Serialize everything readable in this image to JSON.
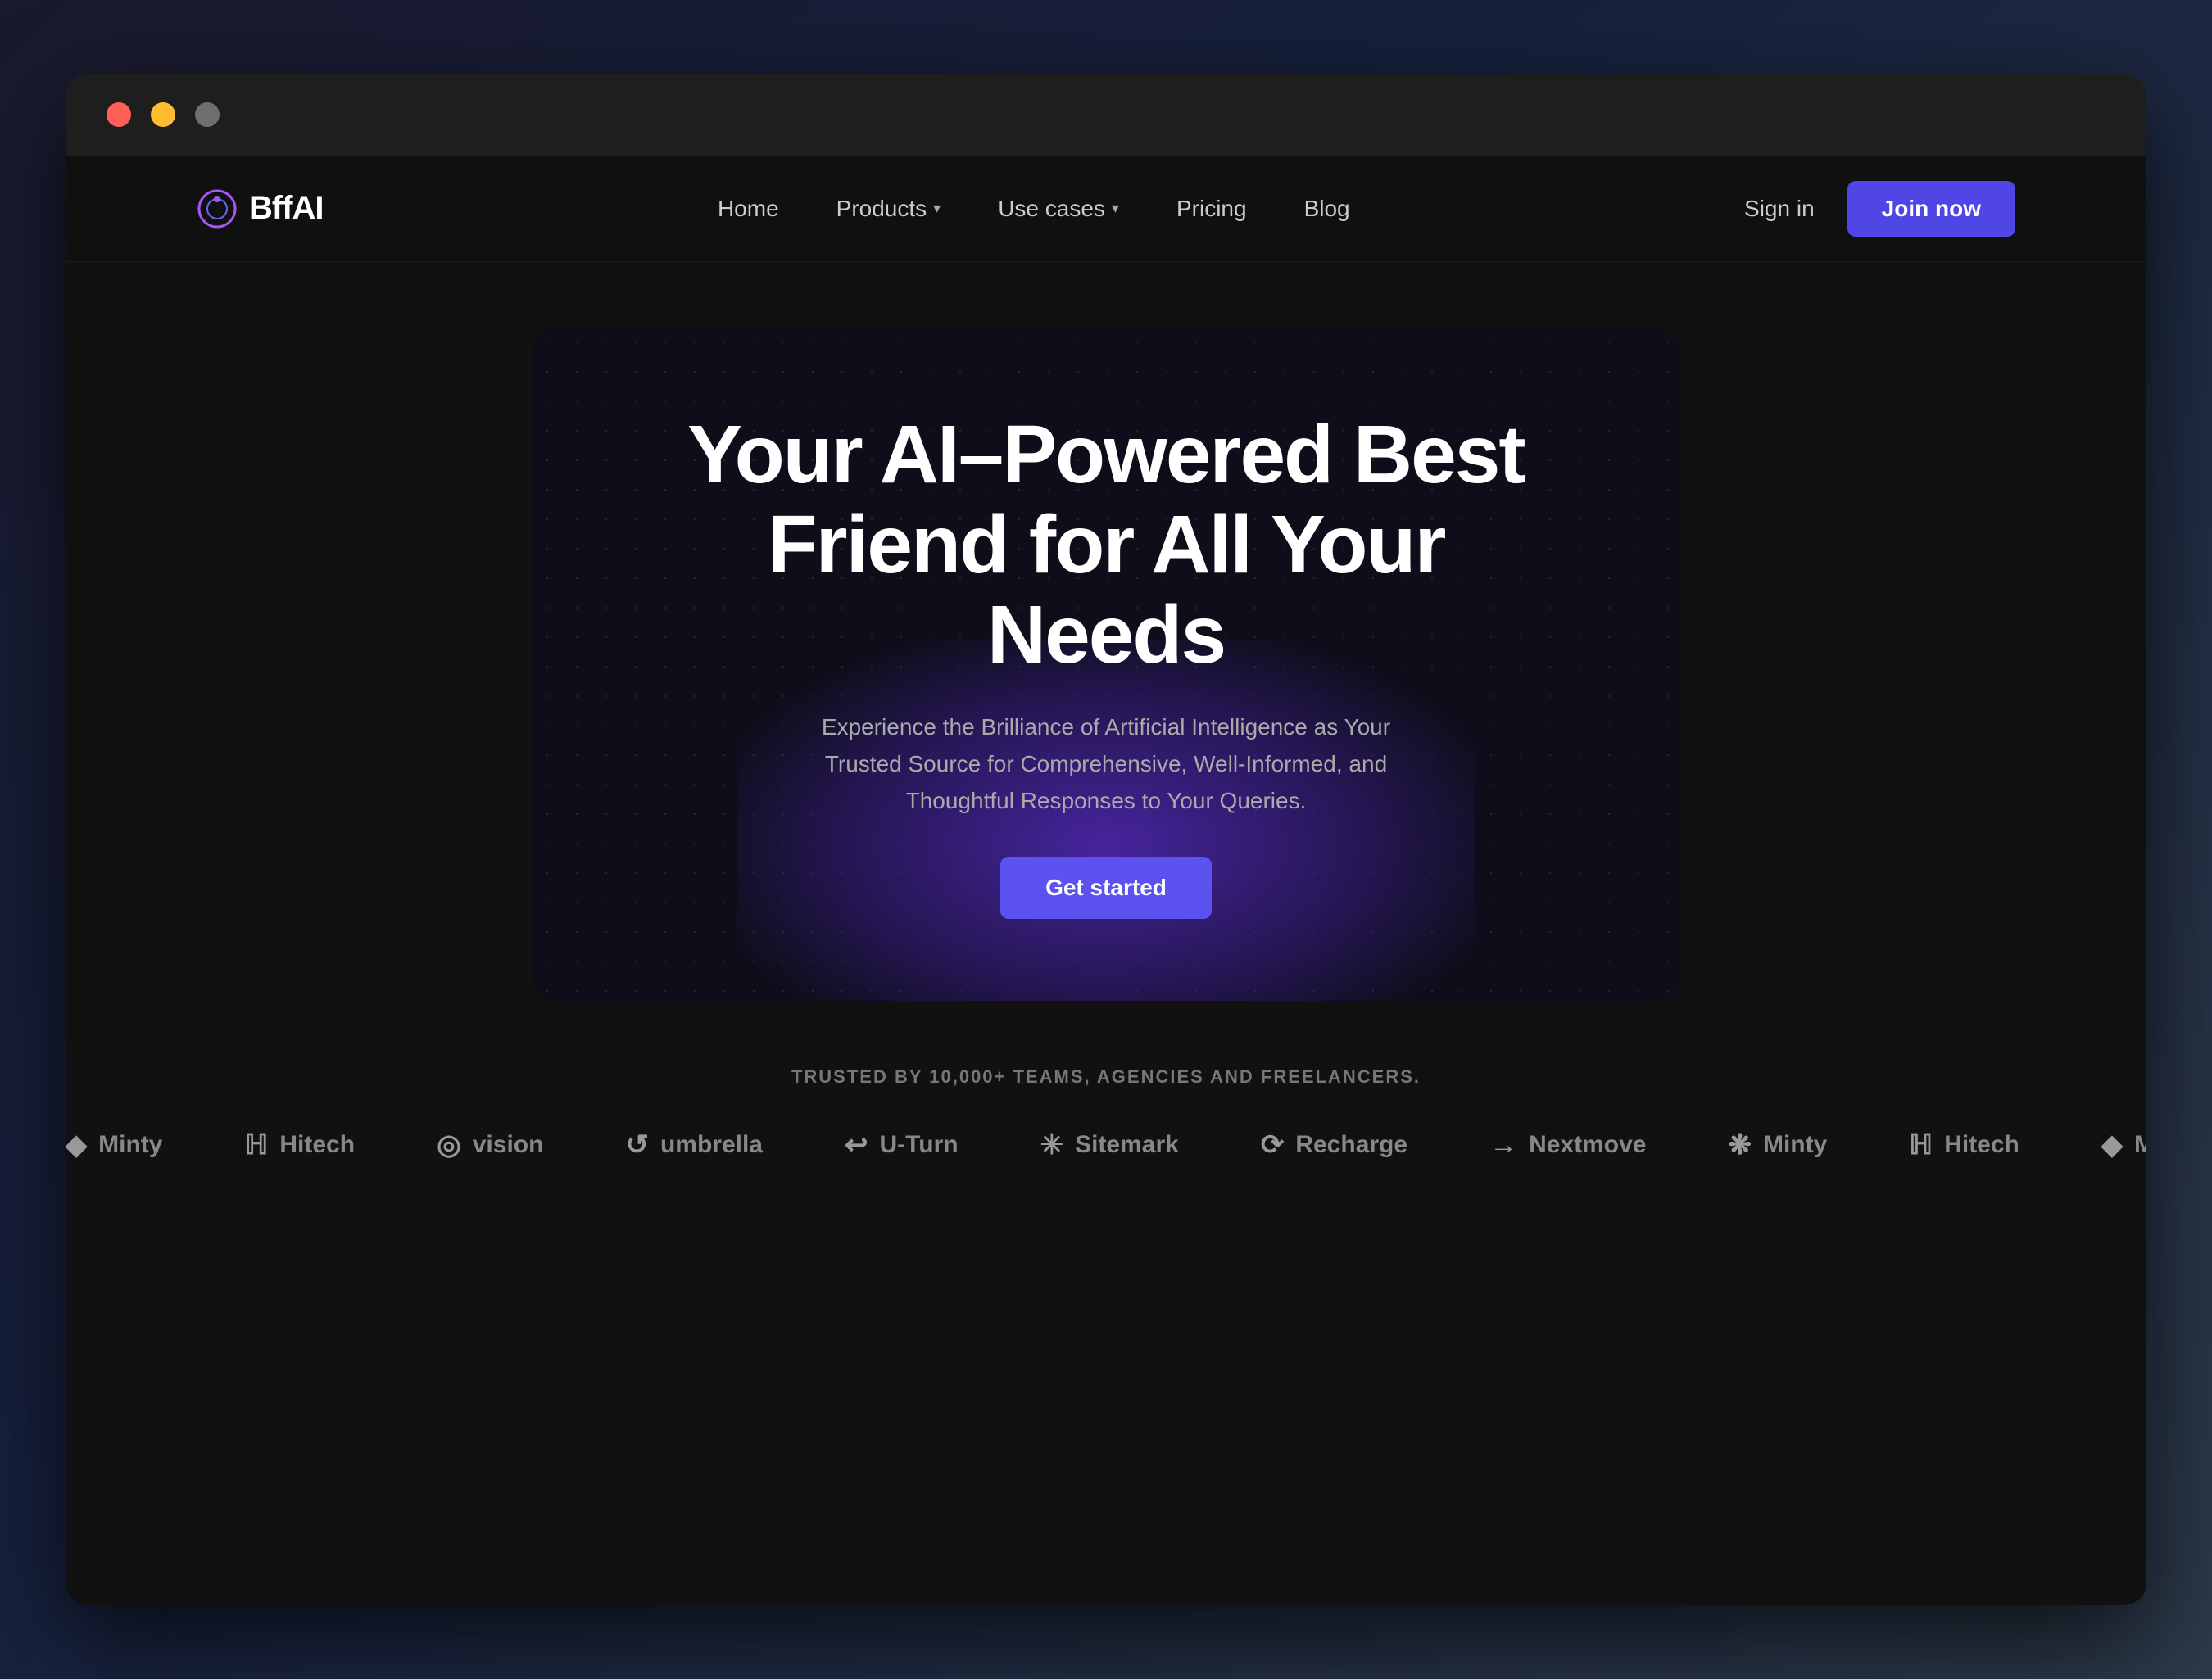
{
  "titlebar": {
    "dots": [
      "red",
      "yellow",
      "gray"
    ]
  },
  "navbar": {
    "logo": {
      "text": "BffAI"
    },
    "links": [
      {
        "label": "Home",
        "hasDropdown": false
      },
      {
        "label": "Products",
        "hasDropdown": true
      },
      {
        "label": "Use cases",
        "hasDropdown": true
      },
      {
        "label": "Pricing",
        "hasDropdown": false
      },
      {
        "label": "Blog",
        "hasDropdown": false
      }
    ],
    "sign_in_label": "Sign in",
    "join_now_label": "Join now"
  },
  "hero": {
    "title_line1": "Your AI–Powered Best",
    "title_line2": "Friend for All Your Needs",
    "subtitle": "Experience the Brilliance of Artificial Intelligence as Your Trusted Source for Comprehensive, Well-Informed, and Thoughtful Responses to Your Queries.",
    "cta_label": "Get started"
  },
  "trust": {
    "label": "TRUSTED BY 10,000+ TEAMS, AGENCIES AND FREELANCERS.",
    "brands": [
      {
        "icon": "◆",
        "name": "Minty"
      },
      {
        "icon": "ℍ",
        "name": "Hitech"
      },
      {
        "icon": "◎",
        "name": "vision"
      },
      {
        "icon": "↺",
        "name": "umbrella"
      },
      {
        "icon": "↩",
        "name": "U-Turn"
      },
      {
        "icon": "✳",
        "name": "Sitemark"
      },
      {
        "icon": "⟳",
        "name": "Recharge"
      },
      {
        "icon": "→",
        "name": "Nextmove"
      },
      {
        "icon": "❋",
        "name": "Minty"
      },
      {
        "icon": "ℍ",
        "name": "Hitech"
      }
    ]
  },
  "colors": {
    "accent": "#4f46e5",
    "accent_hover": "#5b52f0",
    "bg_dark": "#111111",
    "bg_darker": "#0e0e1a"
  }
}
